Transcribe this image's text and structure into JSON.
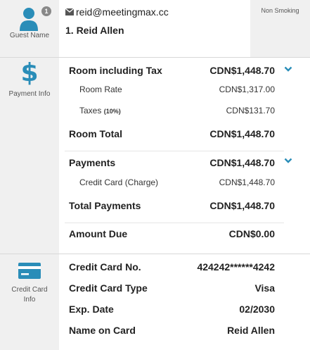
{
  "guest": {
    "section_label": "Guest Name",
    "badge_count": "1",
    "email": "reid@meetingmax.cc",
    "name": "1. Reid Allen",
    "preference": "Non Smoking"
  },
  "payment_info": {
    "section_label": "Payment Info",
    "room_including_tax": {
      "label": "Room including Tax",
      "value": "CDN$1,448.70"
    },
    "room_rate": {
      "label": "Room Rate",
      "value": "CDN$1,317.00"
    },
    "taxes": {
      "label": "Taxes",
      "note": "(10%)",
      "value": "CDN$131.70"
    },
    "room_total": {
      "label": "Room Total",
      "value": "CDN$1,448.70"
    },
    "payments": {
      "label": "Payments",
      "value": "CDN$1,448.70"
    },
    "credit_card_charge": {
      "label": "Credit Card (Charge)",
      "value": "CDN$1,448.70"
    },
    "total_payments": {
      "label": "Total Payments",
      "value": "CDN$1,448.70"
    },
    "amount_due": {
      "label": "Amount Due",
      "value": "CDN$0.00"
    }
  },
  "credit_card_info": {
    "section_label": "Credit Card Info",
    "number": {
      "label": "Credit Card No.",
      "value": "424242******4242"
    },
    "type": {
      "label": "Credit Card Type",
      "value": "Visa"
    },
    "exp": {
      "label": "Exp. Date",
      "value": "02/2030"
    },
    "name": {
      "label": "Name on Card",
      "value": "Reid Allen"
    }
  },
  "colors": {
    "accent": "#2a8db8",
    "sidebar_bg": "#f0f0f0",
    "badge": "#888888"
  },
  "icons": [
    "person-icon",
    "dollar-icon",
    "credit-card-icon",
    "envelope-icon",
    "chevron-down-icon"
  ]
}
